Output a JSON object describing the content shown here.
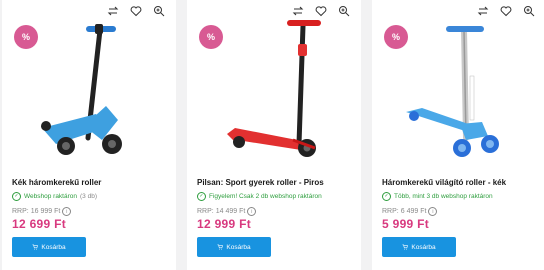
{
  "products": [
    {
      "badge": "%",
      "title": "Kék háromkerekű roller",
      "stock_text": "Webshop raktáron",
      "stock_extra": "(3 db)",
      "rrp_label": "RRP:",
      "rrp_value": "16 999 Ft",
      "price": "12 699 Ft",
      "cart_label": "Kosárba",
      "colors": {
        "deck": "#3ea0e0",
        "stem": "#222222",
        "wheel": "#222222",
        "grip": "#2a7bd0"
      }
    },
    {
      "badge": "%",
      "title": "Pilsan: Sport gyerek roller - Piros",
      "stock_text": "Figyelem! Csak 2 db webshop raktáron",
      "stock_extra": "",
      "rrp_label": "RRP:",
      "rrp_value": "14 499 Ft",
      "price": "12 999 Ft",
      "cart_label": "Kosárba",
      "colors": {
        "deck": "#e23030",
        "stem": "#222222",
        "wheel": "#222222",
        "grip": "#d82020"
      }
    },
    {
      "badge": "%",
      "title": "Háromkerekű világító roller - kék",
      "stock_text": "Több, mint 3 db webshop raktáron",
      "stock_extra": "",
      "rrp_label": "RRP:",
      "rrp_value": "6 499 Ft",
      "price": "5 999 Ft",
      "cart_label": "Kosárba",
      "colors": {
        "deck": "#4aa8e8",
        "stem": "#c8c8c8",
        "wheel": "#2a6fd8",
        "grip": "#3a86d8"
      }
    }
  ],
  "icons": {
    "compare": "compare-icon",
    "wishlist": "heart-icon",
    "zoom": "zoom-icon",
    "cart": "cart-icon",
    "stock": "check-circle-icon",
    "info": "info-icon"
  },
  "theme": {
    "price_color": "#d8397f",
    "button_color": "#1893e0",
    "badge_color": "#d85a93",
    "stock_color": "#2e9e3e"
  }
}
